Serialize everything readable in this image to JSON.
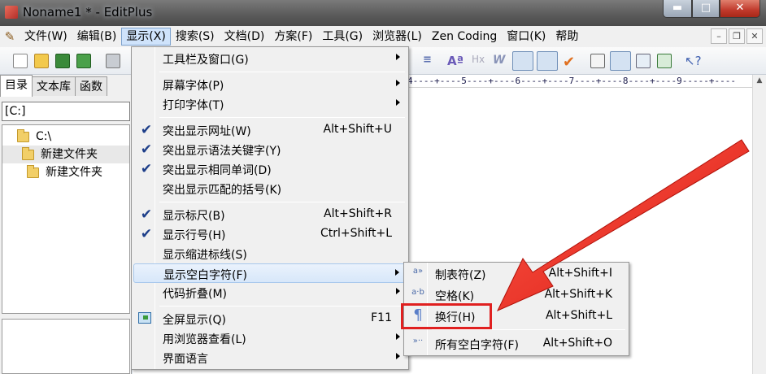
{
  "window": {
    "title": "Noname1 * - EditPlus"
  },
  "menubar": {
    "items": [
      "文件(W)",
      "编辑(B)",
      "显示(X)",
      "搜索(S)",
      "文档(D)",
      "方案(F)",
      "工具(G)",
      "浏览器(L)",
      "Zen Coding",
      "窗口(K)",
      "帮助"
    ]
  },
  "left_panel": {
    "tabs": [
      "目录",
      "文本库",
      "函数"
    ],
    "drive": "[C:]",
    "tree": [
      "C:\\",
      "新建文件夹",
      "新建文件夹"
    ]
  },
  "editor": {
    "ruler": "4----+----5----+----6----+----7----+----8----+----9-----+----"
  },
  "view_menu": {
    "items": [
      {
        "label": "工具栏及窗口(G)",
        "shortcut": ""
      },
      {
        "label": "屏幕字体(P)",
        "shortcut": ""
      },
      {
        "label": "打印字体(T)",
        "shortcut": ""
      },
      {
        "label": "突出显示网址(W)",
        "shortcut": "Alt+Shift+U"
      },
      {
        "label": "突出显示语法关键字(Y)",
        "shortcut": ""
      },
      {
        "label": "突出显示相同单词(D)",
        "shortcut": ""
      },
      {
        "label": "突出显示匹配的括号(K)",
        "shortcut": ""
      },
      {
        "label": "显示标尺(B)",
        "shortcut": "Alt+Shift+R"
      },
      {
        "label": "显示行号(H)",
        "shortcut": "Ctrl+Shift+L"
      },
      {
        "label": "显示缩进标线(S)",
        "shortcut": ""
      },
      {
        "label": "显示空白字符(F)",
        "shortcut": ""
      },
      {
        "label": "代码折叠(M)",
        "shortcut": ""
      },
      {
        "label": "全屏显示(Q)",
        "shortcut": "F11"
      },
      {
        "label": "用浏览器查看(L)",
        "shortcut": ""
      },
      {
        "label": "界面语言",
        "shortcut": ""
      }
    ]
  },
  "whitespace_submenu": {
    "items": [
      {
        "icon": "a»",
        "label": "制表符(Z)",
        "shortcut": "Alt+Shift+I"
      },
      {
        "icon": "a·b",
        "label": "空格(K)",
        "shortcut": "Alt+Shift+K"
      },
      {
        "icon": "¶",
        "label": "换行(H)",
        "shortcut": "Alt+Shift+L"
      },
      {
        "icon": "»··",
        "label": "所有空白字符(F)",
        "shortcut": "Alt+Shift+O"
      }
    ]
  },
  "colors": {
    "annotation_red": "#e02020",
    "check_blue": "#1e3f8a",
    "highlight": "#d7e7fa"
  }
}
